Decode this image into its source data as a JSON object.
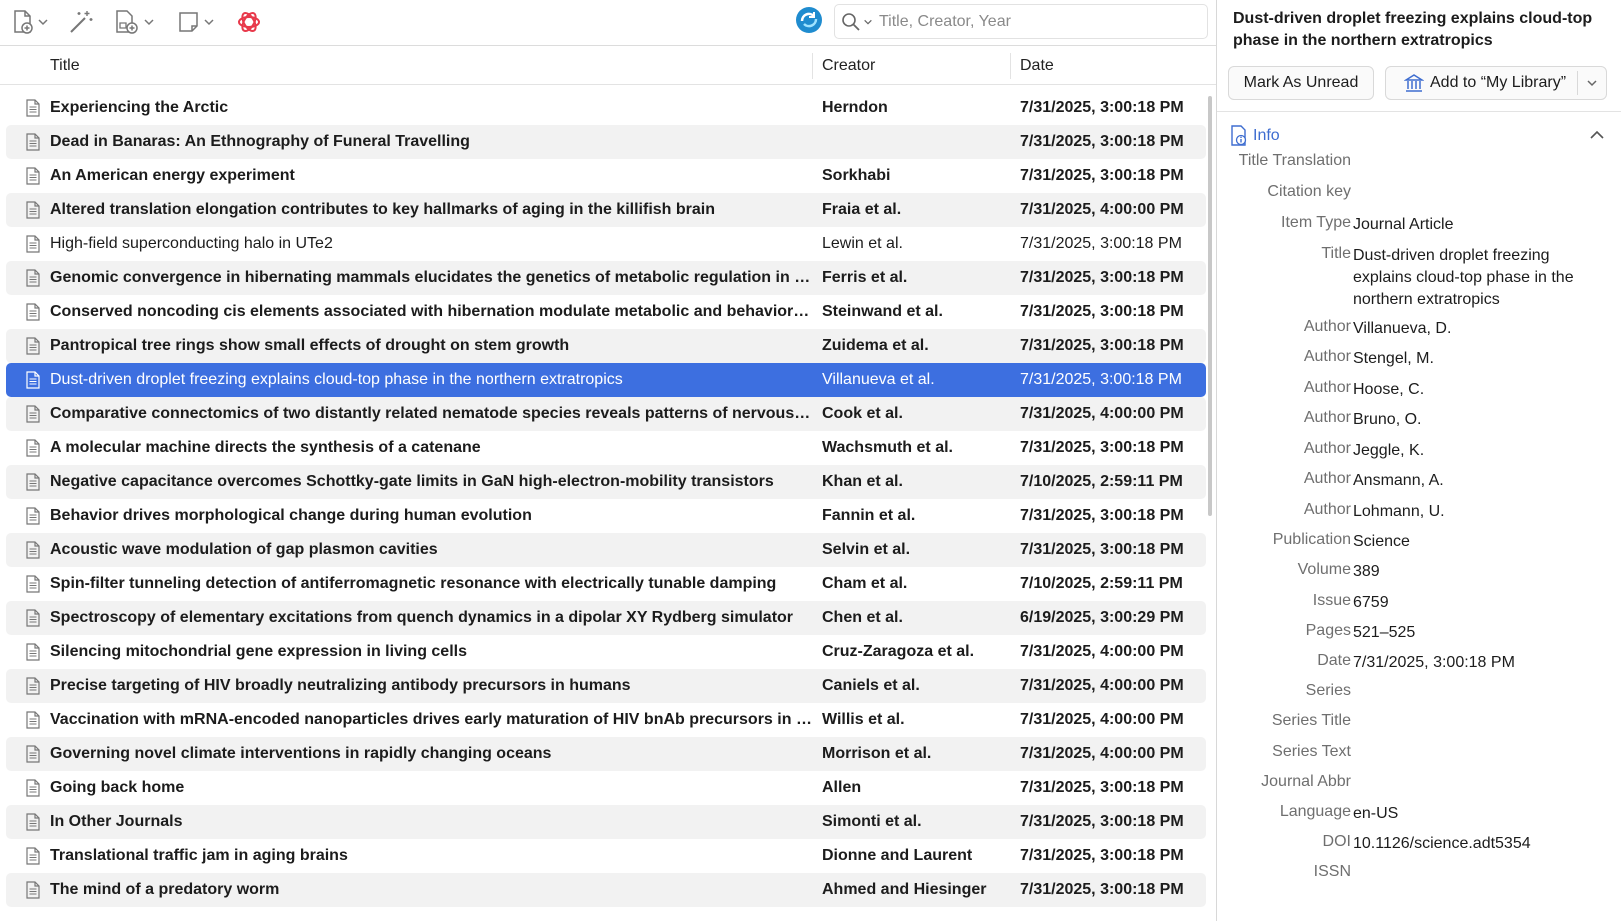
{
  "toolbar": {
    "search_placeholder": "Title, Creator, Year"
  },
  "columns": {
    "title": "Title",
    "creator": "Creator",
    "date": "Date"
  },
  "rows": [
    {
      "title": "Experiencing the Arctic",
      "creator": "Herndon",
      "date": "7/31/2025, 3:00:18 PM",
      "unread": true
    },
    {
      "title": "Dead in Banaras: An Ethnography of Funeral Travelling",
      "creator": "",
      "date": "7/31/2025, 3:00:18 PM",
      "unread": true
    },
    {
      "title": "An American energy experiment",
      "creator": "Sorkhabi",
      "date": "7/31/2025, 3:00:18 PM",
      "unread": true
    },
    {
      "title": "Altered translation elongation contributes to key hallmarks of aging in the killifish brain",
      "creator": "Fraia et al.",
      "date": "7/31/2025, 4:00:00 PM",
      "unread": true
    },
    {
      "title": "High-field superconducting halo in UTe2",
      "creator": "Lewin et al.",
      "date": "7/31/2025, 3:00:18 PM",
      "unread": false
    },
    {
      "title": "Genomic convergence in hibernating mammals elucidates the genetics of metabolic regulation in the hypothalamus",
      "creator": "Ferris et al.",
      "date": "7/31/2025, 3:00:18 PM",
      "unread": true
    },
    {
      "title": "Conserved noncoding cis elements associated with hibernation modulate metabolic and behavioral adaptations in mice",
      "creator": "Steinwand et al.",
      "date": "7/31/2025, 3:00:18 PM",
      "unread": true
    },
    {
      "title": "Pantropical tree rings show small effects of drought on stem growth",
      "creator": "Zuidema et al.",
      "date": "7/31/2025, 3:00:18 PM",
      "unread": true
    },
    {
      "title": "Dust-driven droplet freezing explains cloud-top phase in the northern extratropics",
      "creator": "Villanueva et al.",
      "date": "7/31/2025, 3:00:18 PM",
      "unread": false,
      "selected": true
    },
    {
      "title": "Comparative connectomics of two distantly related nematode species reveals patterns of nervous system evolution",
      "creator": "Cook et al.",
      "date": "7/31/2025, 4:00:00 PM",
      "unread": true
    },
    {
      "title": "A molecular machine directs the synthesis of a catenane",
      "creator": "Wachsmuth et al.",
      "date": "7/31/2025, 3:00:18 PM",
      "unread": true
    },
    {
      "title": "Negative capacitance overcomes Schottky-gate limits in GaN high-electron-mobility transistors",
      "creator": "Khan et al.",
      "date": "7/10/2025, 2:59:11 PM",
      "unread": true
    },
    {
      "title": "Behavior drives morphological change during human evolution",
      "creator": "Fannin et al.",
      "date": "7/31/2025, 3:00:18 PM",
      "unread": true
    },
    {
      "title": "Acoustic wave modulation of gap plasmon cavities",
      "creator": "Selvin et al.",
      "date": "7/31/2025, 3:00:18 PM",
      "unread": true
    },
    {
      "title": "Spin-filter tunneling detection of antiferromagnetic resonance with electrically tunable damping",
      "creator": "Cham et al.",
      "date": "7/10/2025, 2:59:11 PM",
      "unread": true
    },
    {
      "title": "Spectroscopy of elementary excitations from quench dynamics in a dipolar XY Rydberg simulator",
      "creator": "Chen et al.",
      "date": "6/19/2025, 3:00:29 PM",
      "unread": true
    },
    {
      "title": "Silencing mitochondrial gene expression in living cells",
      "creator": "Cruz-Zaragoza et al.",
      "date": "7/31/2025, 4:00:00 PM",
      "unread": true
    },
    {
      "title": "Precise targeting of HIV broadly neutralizing antibody precursors in humans",
      "creator": "Caniels et al.",
      "date": "7/31/2025, 4:00:00 PM",
      "unread": true
    },
    {
      "title": "Vaccination with mRNA-encoded nanoparticles drives early maturation of HIV bnAb precursors in humans",
      "creator": "Willis et al.",
      "date": "7/31/2025, 4:00:00 PM",
      "unread": true
    },
    {
      "title": "Governing novel climate interventions in rapidly changing oceans",
      "creator": "Morrison et al.",
      "date": "7/31/2025, 4:00:00 PM",
      "unread": true
    },
    {
      "title": "Going back home",
      "creator": "Allen",
      "date": "7/31/2025, 3:00:18 PM",
      "unread": true
    },
    {
      "title": "In Other Journals",
      "creator": "Simonti et al.",
      "date": "7/31/2025, 3:00:18 PM",
      "unread": true
    },
    {
      "title": "Translational traffic jam in aging brains",
      "creator": "Dionne and Laurent",
      "date": "7/31/2025, 3:00:18 PM",
      "unread": true
    },
    {
      "title": "The mind of a predatory worm",
      "creator": "Ahmed and Hiesinger",
      "date": "7/31/2025, 3:00:18 PM",
      "unread": true
    }
  ],
  "detail": {
    "header_title": "Dust-driven droplet freezing explains cloud-top phase in the northern extratropics",
    "mark_unread": "Mark As Unread",
    "add_library": "Add to “My Library”",
    "info_label": "Info",
    "fields": [
      {
        "label": "Title Translation",
        "value": ""
      },
      {
        "label": "Citation key",
        "value": ""
      },
      {
        "label": "Item Type",
        "value": "Journal Article"
      },
      {
        "label": "Title",
        "value": "Dust-driven droplet freezing explains cloud-top phase in the northern extratropics"
      },
      {
        "label": "Author",
        "value": "Villanueva, D."
      },
      {
        "label": "Author",
        "value": "Stengel, M."
      },
      {
        "label": "Author",
        "value": "Hoose, C."
      },
      {
        "label": "Author",
        "value": "Bruno, O."
      },
      {
        "label": "Author",
        "value": "Jeggle, K."
      },
      {
        "label": "Author",
        "value": "Ansmann, A."
      },
      {
        "label": "Author",
        "value": "Lohmann, U."
      },
      {
        "label": "Publication",
        "value": "Science"
      },
      {
        "label": "Volume",
        "value": "389"
      },
      {
        "label": "Issue",
        "value": "6759"
      },
      {
        "label": "Pages",
        "value": "521–525"
      },
      {
        "label": "Date",
        "value": "7/31/2025, 3:00:18 PM"
      },
      {
        "label": "Series",
        "value": ""
      },
      {
        "label": "Series Title",
        "value": ""
      },
      {
        "label": "Series Text",
        "value": ""
      },
      {
        "label": "Journal Abbr",
        "value": ""
      },
      {
        "label": "Language",
        "value": "en-US"
      },
      {
        "label": "DOI",
        "value": "10.1126/science.adt5354"
      },
      {
        "label": "ISSN",
        "value": ""
      }
    ]
  },
  "colors": {
    "selection": "#3d6fe0",
    "accent": "#3e6dd0",
    "openai_icon": "#e8394b",
    "sync_icon": "#1f8ccf"
  }
}
